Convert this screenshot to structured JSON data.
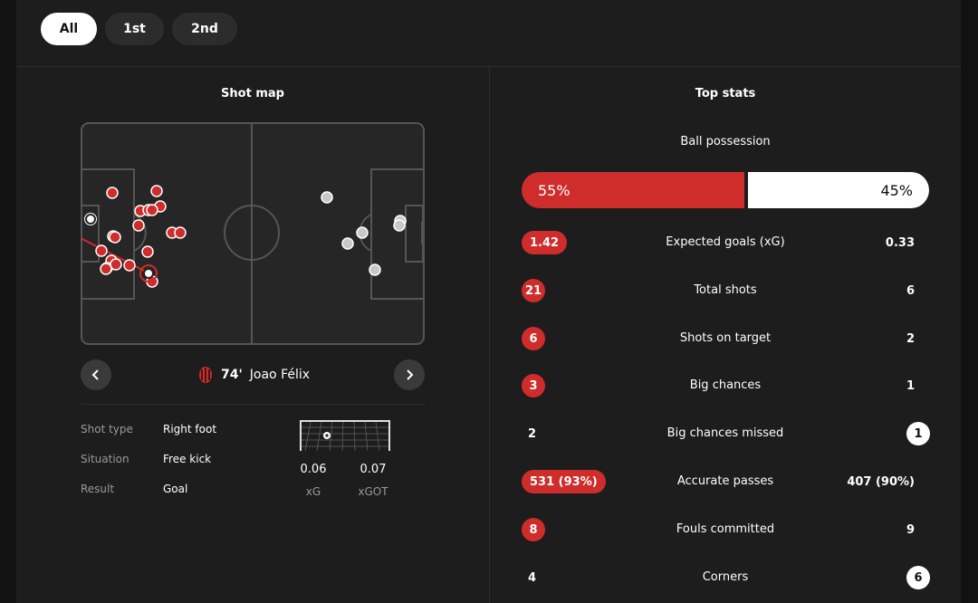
{
  "tabs": [
    {
      "label": "All",
      "active": true
    },
    {
      "label": "1st",
      "active": false
    },
    {
      "label": "2nd",
      "active": false
    }
  ],
  "shot_map": {
    "title": "Shot map",
    "selected_shot": {
      "minute": "74'",
      "player": "Joao Félix",
      "details": [
        {
          "label": "Shot type",
          "value": "Right foot"
        },
        {
          "label": "Situation",
          "value": "Free kick"
        },
        {
          "label": "Result",
          "value": "Goal"
        }
      ],
      "xg": {
        "value": "0.06",
        "label": "xG"
      },
      "xgot": {
        "value": "0.07",
        "label": "xGOT"
      }
    },
    "colors": {
      "home": "#cf2c2c",
      "away": "#c8c8c8"
    }
  },
  "top_stats": {
    "title": "Top stats",
    "possession": {
      "label": "Ball possession",
      "home": "55%",
      "away": "45%",
      "home_fraction": 0.55
    },
    "rows": [
      {
        "label": "Expected goals (xG)",
        "home": "1.42",
        "away": "0.33",
        "highlight": "home"
      },
      {
        "label": "Total shots",
        "home": "21",
        "away": "6",
        "highlight": "home"
      },
      {
        "label": "Shots on target",
        "home": "6",
        "away": "2",
        "highlight": "home"
      },
      {
        "label": "Big chances",
        "home": "3",
        "away": "1",
        "highlight": "home"
      },
      {
        "label": "Big chances missed",
        "home": "2",
        "away": "1",
        "highlight": "away"
      },
      {
        "label": "Accurate passes",
        "home": "531 (93%)",
        "away": "407 (90%)",
        "highlight": "home"
      },
      {
        "label": "Fouls committed",
        "home": "8",
        "away": "9",
        "highlight": "home"
      },
      {
        "label": "Corners",
        "home": "4",
        "away": "6",
        "highlight": "away"
      }
    ]
  },
  "icons": {
    "prev": "chevron-left-icon",
    "next": "chevron-right-icon",
    "team": "team-crest-icon",
    "goal": "goal-frame-icon"
  }
}
